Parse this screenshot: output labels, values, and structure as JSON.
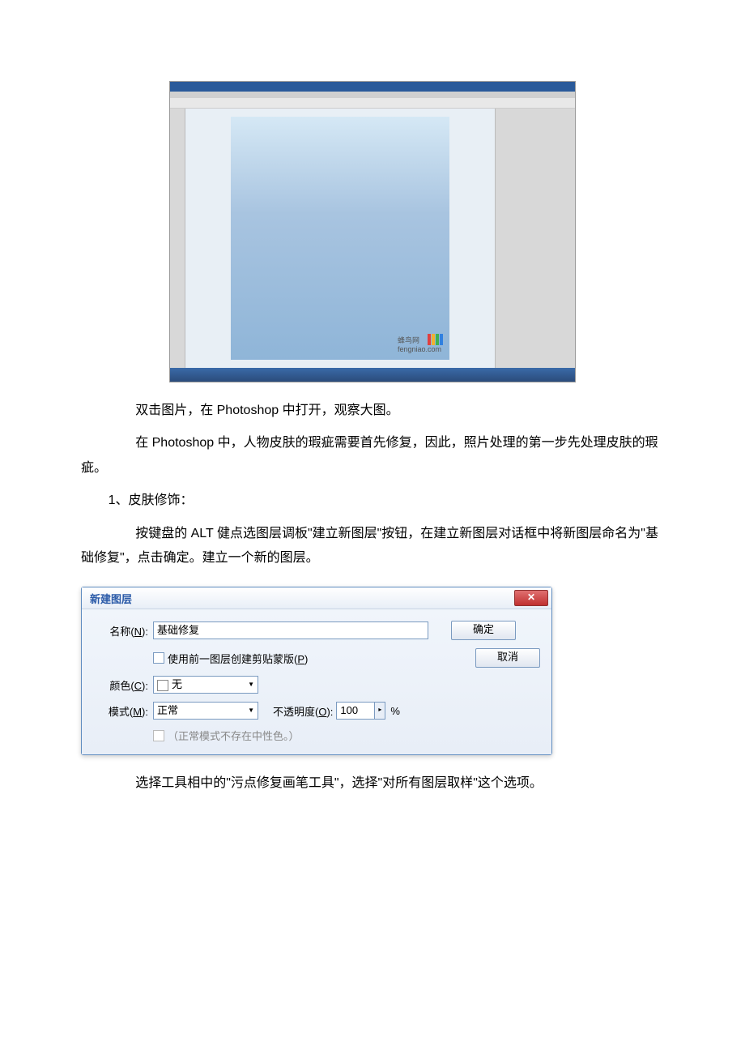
{
  "screenshot": {
    "watermark": "蜂鸟网",
    "watermark_url": "fengniao.com"
  },
  "paragraphs": {
    "p1": "双击图片，在 Photoshop 中打开，观察大图。",
    "p2": "在 Photoshop 中，人物皮肤的瑕疵需要首先修复，因此，照片处理的第一步先处理皮肤的瑕疵。",
    "p3": "1、皮肤修饰：",
    "p4": "按键盘的 ALT 健点选图层调板\"建立新图层\"按钮，在建立新图层对话框中将新图层命名为\"基础修复\"，点击确定。建立一个新的图层。",
    "p5": "选择工具相中的\"污点修复画笔工具\"，选择\"对所有图层取样\"这个选项。"
  },
  "dialog": {
    "title": "新建图层",
    "close": "✕",
    "name_label_prefix": "名称(",
    "name_key": "N",
    "name_label_suffix": "):",
    "name_value": "基础修复",
    "ok": "确定",
    "cancel": "取消",
    "clip_label_prefix": "使用前一图层创建剪贴蒙版(",
    "clip_key": "P",
    "clip_label_suffix": ")",
    "color_label_prefix": "颜色(",
    "color_key": "C",
    "color_label_suffix": "):",
    "color_value": "无",
    "mode_label_prefix": "模式(",
    "mode_key": "M",
    "mode_label_suffix": "):",
    "mode_value": "正常",
    "opacity_label_prefix": "不透明度(",
    "opacity_key": "O",
    "opacity_label_suffix": "):",
    "opacity_value": "100",
    "opacity_unit": "%",
    "neutral_note": "（正常模式不存在中性色。）"
  }
}
